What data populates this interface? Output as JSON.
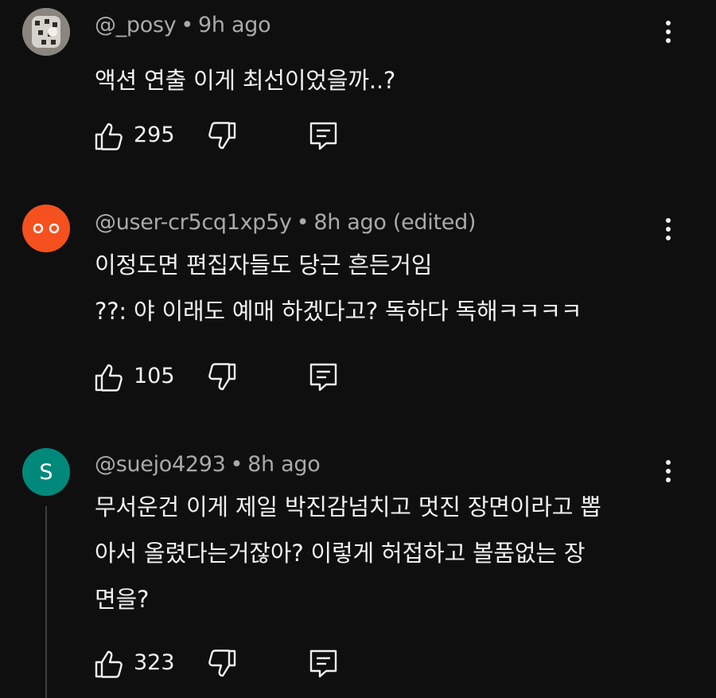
{
  "comments": [
    {
      "author": "@_posy",
      "time": "9h ago",
      "edited": "",
      "avatar": {
        "type": "image",
        "colors": [
          "#c9c4bd",
          "#3a3633"
        ]
      },
      "lines": [
        "액션 연출 이게 최선이었을까..?"
      ],
      "likes": "295"
    },
    {
      "author": "@user-cr5cq1xp5y",
      "time": "8h ago",
      "edited": "(edited)",
      "avatar": {
        "type": "eyes",
        "color": "#f4511e"
      },
      "lines": [
        "이정도면 편집자들도 당근 흔든거임",
        "??: 야 이래도 예매 하겠다고? 독하다 독해ㅋㅋㅋㅋ"
      ],
      "likes": "105"
    },
    {
      "author": "@suejo4293",
      "time": "8h ago",
      "edited": "",
      "avatar": {
        "type": "letter",
        "letter": "S",
        "color": "#00897b"
      },
      "lines": [
        "무서운건 이게 제일 박진감넘치고 멋진 장면이라고 뽑",
        "아서 올렸다는거잖아? 이렇게 허접하고 볼품없는 장",
        "면을?"
      ],
      "likes": "323"
    }
  ],
  "icons": {
    "like": "thumb-up-icon",
    "dislike": "thumb-down-icon",
    "reply": "reply-icon",
    "more": "more-vert-icon"
  },
  "colors": {
    "background": "#0f0f0f",
    "text": "#f1f1f1",
    "meta": "#aaaaaa"
  }
}
